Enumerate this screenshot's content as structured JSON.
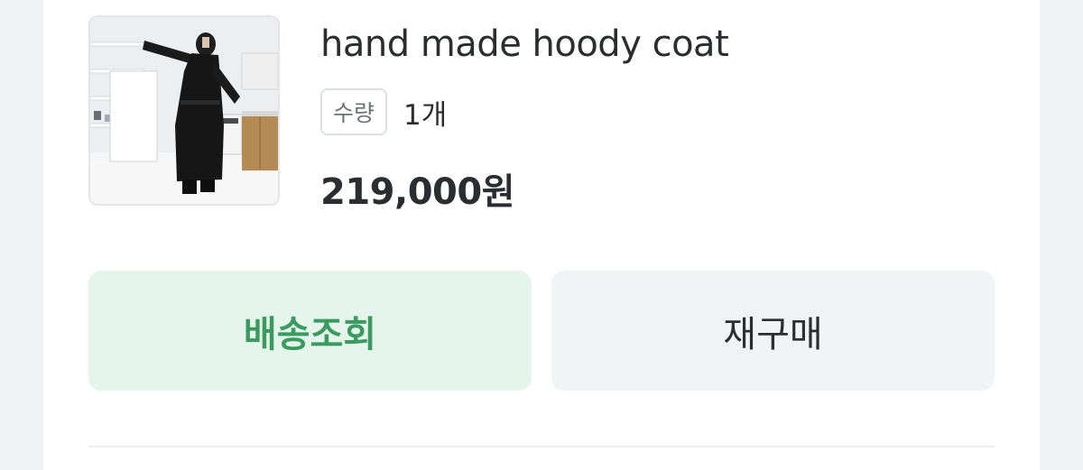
{
  "product": {
    "name": "hand made hoody coat",
    "quantity_label": "수량",
    "quantity_value": "1개",
    "price": "219,000원"
  },
  "actions": {
    "track_label": "배송조회",
    "reorder_label": "재구매"
  },
  "colors": {
    "track_bg": "#e6f5ec",
    "track_text": "#3b9a5f",
    "reorder_bg": "#f2f3f5",
    "text": "#2b2d31"
  }
}
